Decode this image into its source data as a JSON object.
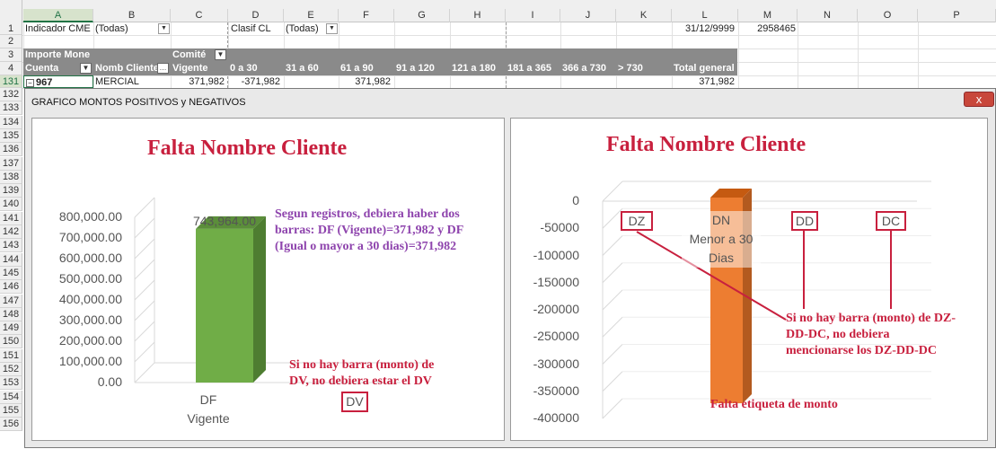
{
  "columns": [
    "A",
    "B",
    "C",
    "D",
    "E",
    "F",
    "G",
    "H",
    "I",
    "J",
    "K",
    "L",
    "M",
    "N",
    "O",
    "P"
  ],
  "rows": {
    "top": [
      "1",
      "2",
      "3",
      "4",
      "131"
    ],
    "under": [
      "132",
      "133",
      "134",
      "135",
      "136",
      "137",
      "138",
      "139",
      "140",
      "141",
      "142",
      "143",
      "144",
      "145",
      "146",
      "147",
      "148",
      "149",
      "150",
      "151",
      "152",
      "153",
      "154",
      "155",
      "156"
    ]
  },
  "filters": {
    "indicador_label": "Indicador CME",
    "indicador_value": "(Todas)",
    "clasif_label": "Clasif CL",
    "clasif_value": "(Todas)",
    "date": "31/12/9999",
    "number": "2958465"
  },
  "pivot": {
    "importe": "Importe Mone",
    "comite": "Comité",
    "headers": [
      "Cuenta",
      "Nomb Cliente",
      "Vigente",
      "0 a 30",
      "31 a 60",
      "61 a 90",
      "91 a 120",
      "121 a 180",
      "181 a 365",
      "366 a 730",
      "> 730",
      "Total general"
    ],
    "row": {
      "cuenta": "967",
      "cliente": "MERCIAL",
      "vigente": "371,982",
      "d0_30": "-371,982",
      "d61_90": "371,982",
      "total": "371,982"
    }
  },
  "window": {
    "title": "GRAFICO MONTOS POSITIVOS y NEGATIVOS",
    "close_glyph": "x"
  },
  "chart_left": {
    "title": "Falta Nombre Cliente",
    "annotations": {
      "main": [
        "Segun registros, debiera haber dos",
        "barras: DF (Vigente)=371,982 y DF",
        "(Igual o mayor a 30 dias)=371,982"
      ],
      "dv": [
        "Si no hay barra (monto) de",
        "DV, no debiera estar el DV"
      ],
      "dv_box": "DV"
    }
  },
  "chart_right": {
    "title": "Falta Nombre Cliente",
    "boxes": [
      "DZ",
      "DD",
      "DC"
    ],
    "dn_label": [
      "DN",
      "Menor a 30",
      "Dias"
    ],
    "annotations": {
      "main": [
        "Si no hay barra (monto) de DZ-",
        "DD-DC, no debiera",
        "mencionarse los DZ-DD-DC"
      ],
      "falta": "Falta etiqueta de monto"
    }
  },
  "chart_data": [
    {
      "type": "bar",
      "title": "Falta Nombre Cliente",
      "categories": [
        [
          "DF",
          "Vigente"
        ]
      ],
      "values": [
        743964
      ],
      "data_labels": [
        "743,964.00"
      ],
      "ylim": [
        0,
        800000
      ],
      "yticks": [
        "800,000.00",
        "700,000.00",
        "600,000.00",
        "500,000.00",
        "400,000.00",
        "300,000.00",
        "200,000.00",
        "100,000.00",
        "0.00"
      ],
      "color": "#70ad47"
    },
    {
      "type": "bar",
      "title": "Falta Nombre Cliente",
      "categories": [
        "DN Menor a 30 Dias"
      ],
      "values": [
        -371982
      ],
      "ylim": [
        -400000,
        0
      ],
      "yticks": [
        "0",
        "-50000",
        "-100000",
        "-150000",
        "-200000",
        "-250000",
        "-300000",
        "-350000",
        "-400000"
      ],
      "color": "#ed7d31"
    }
  ],
  "colors": {
    "bar_green": "#70ad47",
    "bar_orange": "#ed7d31",
    "annotation_red": "#c8203e",
    "annotation_purple": "#8e44ad",
    "pivot_header": "#8a8a8a"
  }
}
